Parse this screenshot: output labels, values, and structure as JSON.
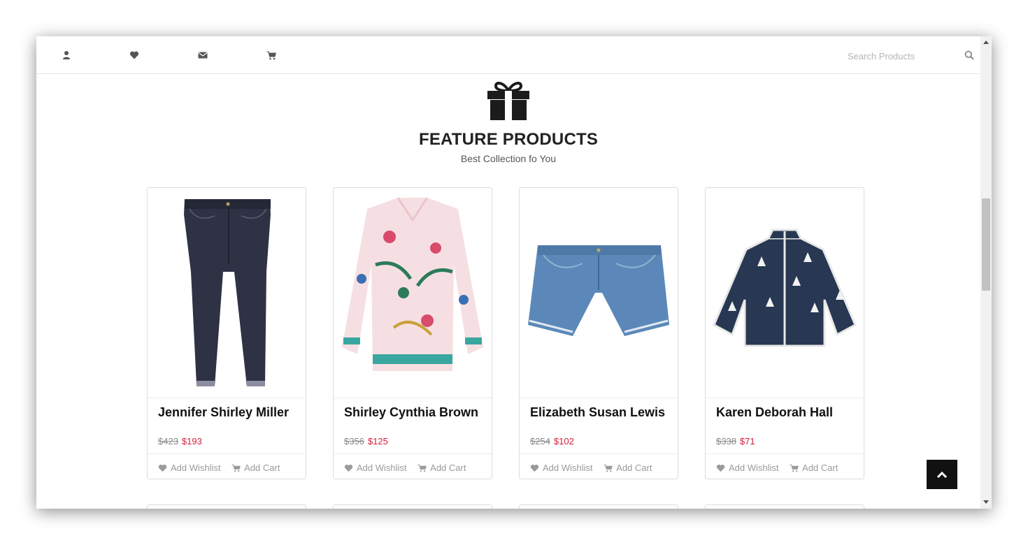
{
  "header": {
    "icons": [
      "user-icon",
      "heart-icon",
      "envelope-icon",
      "cart-icon"
    ],
    "search": {
      "placeholder": "Search Products",
      "icon": "search-icon"
    }
  },
  "section": {
    "icon": "gift-icon",
    "title": "FEATURE PRODUCTS",
    "subtitle": "Best Collection fo You"
  },
  "products": [
    {
      "name": "Jennifer Shirley Miller",
      "old_price": "$423",
      "new_price": "$193",
      "image": "dark-denim-jeans"
    },
    {
      "name": "Shirley Cynthia Brown",
      "old_price": "$356",
      "new_price": "$125",
      "image": "floral-print-blouse"
    },
    {
      "name": "Elizabeth Susan Lewis",
      "old_price": "$254",
      "new_price": "$102",
      "image": "denim-shorts"
    },
    {
      "name": "Karen Deborah Hall",
      "old_price": "$338",
      "new_price": "$71",
      "image": "navy-kids-jacket"
    }
  ],
  "product_actions": {
    "wishlist_label": "Add Wishlist",
    "cart_label": "Add Cart"
  },
  "colors": {
    "sale_price": "#d1203b",
    "old_price": "#8a8a8a",
    "back_to_top_bg": "#111111"
  },
  "back_to_top": {
    "icon": "chevron-up-icon"
  }
}
